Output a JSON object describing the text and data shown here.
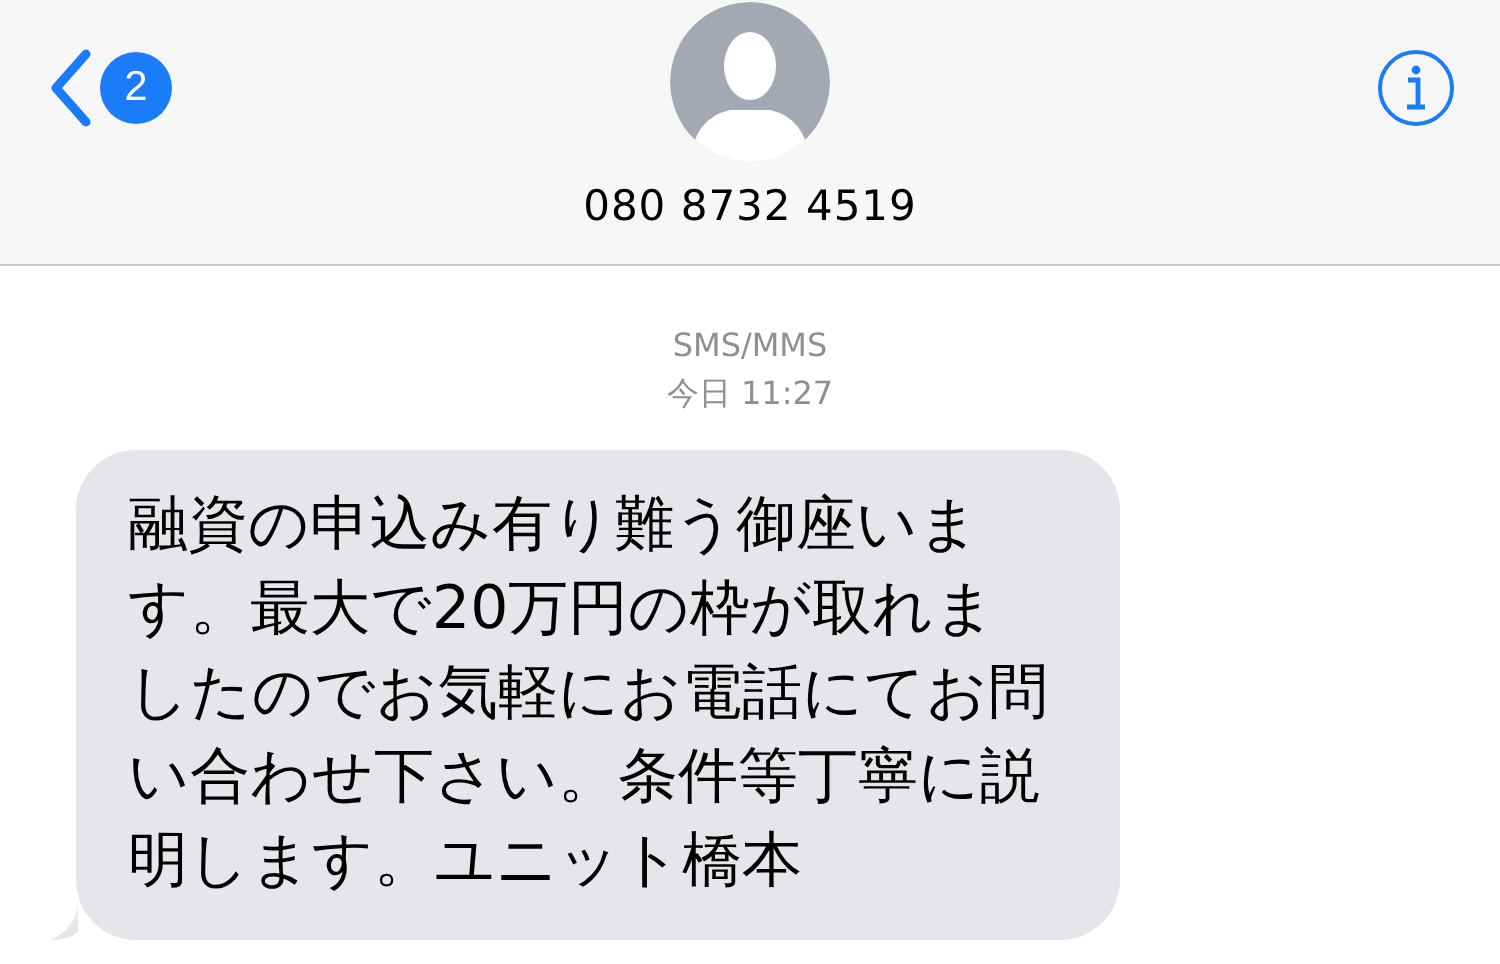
{
  "header": {
    "back_badge": "2",
    "contact": "080 8732 4519"
  },
  "conversation": {
    "service": "SMS/MMS",
    "timestamp": "今日 11:27",
    "messages": [
      {
        "kind": "incoming",
        "text": "融資の申込み有り難う御座います。最大で20万円の枠が取れましたのでお気軽にお電話にてお問い合わせ下さい。条件等丁寧に説明します。ユニット橋本"
      }
    ]
  }
}
